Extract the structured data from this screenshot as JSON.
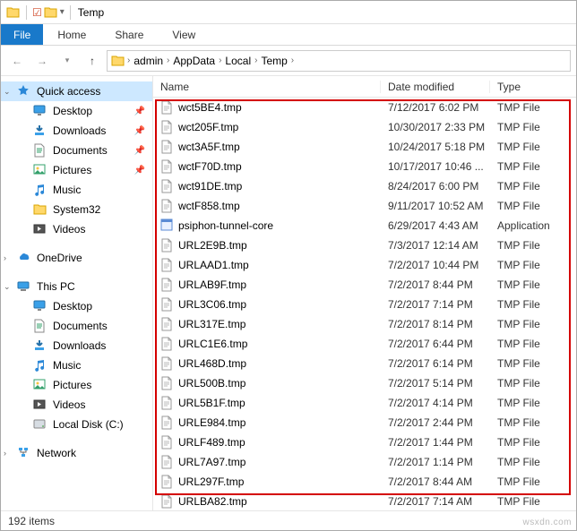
{
  "window": {
    "title": "Temp"
  },
  "ribbon": {
    "file": "File",
    "tabs": [
      "Home",
      "Share",
      "View"
    ]
  },
  "breadcrumb": [
    "admin",
    "AppData",
    "Local",
    "Temp"
  ],
  "columns": {
    "name": "Name",
    "date": "Date modified",
    "type": "Type"
  },
  "nav": {
    "quick_access": {
      "label": "Quick access",
      "items": [
        {
          "label": "Desktop",
          "pinned": true,
          "icon": "desktop"
        },
        {
          "label": "Downloads",
          "pinned": true,
          "icon": "downloads"
        },
        {
          "label": "Documents",
          "pinned": true,
          "icon": "documents"
        },
        {
          "label": "Pictures",
          "pinned": true,
          "icon": "pictures"
        },
        {
          "label": "Music",
          "pinned": false,
          "icon": "music"
        },
        {
          "label": "System32",
          "pinned": false,
          "icon": "folder"
        },
        {
          "label": "Videos",
          "pinned": false,
          "icon": "videos"
        }
      ]
    },
    "onedrive": {
      "label": "OneDrive"
    },
    "this_pc": {
      "label": "This PC",
      "items": [
        {
          "label": "Desktop",
          "icon": "desktop"
        },
        {
          "label": "Documents",
          "icon": "documents"
        },
        {
          "label": "Downloads",
          "icon": "downloads"
        },
        {
          "label": "Music",
          "icon": "music"
        },
        {
          "label": "Pictures",
          "icon": "pictures"
        },
        {
          "label": "Videos",
          "icon": "videos"
        },
        {
          "label": "Local Disk (C:)",
          "icon": "disk"
        }
      ]
    },
    "network": {
      "label": "Network"
    }
  },
  "files": [
    {
      "name": "wct5BE4.tmp",
      "date": "7/12/2017 6:02 PM",
      "type": "TMP File",
      "icon": "file"
    },
    {
      "name": "wct205F.tmp",
      "date": "10/30/2017 2:33 PM",
      "type": "TMP File",
      "icon": "file"
    },
    {
      "name": "wct3A5F.tmp",
      "date": "10/24/2017 5:18 PM",
      "type": "TMP File",
      "icon": "file"
    },
    {
      "name": "wctF70D.tmp",
      "date": "10/17/2017 10:46 ...",
      "type": "TMP File",
      "icon": "file"
    },
    {
      "name": "wct91DE.tmp",
      "date": "8/24/2017 6:00 PM",
      "type": "TMP File",
      "icon": "file"
    },
    {
      "name": "wctF858.tmp",
      "date": "9/11/2017 10:52 AM",
      "type": "TMP File",
      "icon": "file"
    },
    {
      "name": "psiphon-tunnel-core",
      "date": "6/29/2017 4:43 AM",
      "type": "Application",
      "icon": "app"
    },
    {
      "name": "URL2E9B.tmp",
      "date": "7/3/2017 12:14 AM",
      "type": "TMP File",
      "icon": "file"
    },
    {
      "name": "URLAAD1.tmp",
      "date": "7/2/2017 10:44 PM",
      "type": "TMP File",
      "icon": "file"
    },
    {
      "name": "URLAB9F.tmp",
      "date": "7/2/2017 8:44 PM",
      "type": "TMP File",
      "icon": "file"
    },
    {
      "name": "URL3C06.tmp",
      "date": "7/2/2017 7:14 PM",
      "type": "TMP File",
      "icon": "file"
    },
    {
      "name": "URL317E.tmp",
      "date": "7/2/2017 8:14 PM",
      "type": "TMP File",
      "icon": "file"
    },
    {
      "name": "URLC1E6.tmp",
      "date": "7/2/2017 6:44 PM",
      "type": "TMP File",
      "icon": "file"
    },
    {
      "name": "URL468D.tmp",
      "date": "7/2/2017 6:14 PM",
      "type": "TMP File",
      "icon": "file"
    },
    {
      "name": "URL500B.tmp",
      "date": "7/2/2017 5:14 PM",
      "type": "TMP File",
      "icon": "file"
    },
    {
      "name": "URL5B1F.tmp",
      "date": "7/2/2017 4:14 PM",
      "type": "TMP File",
      "icon": "file"
    },
    {
      "name": "URLE984.tmp",
      "date": "7/2/2017 2:44 PM",
      "type": "TMP File",
      "icon": "file"
    },
    {
      "name": "URLF489.tmp",
      "date": "7/2/2017 1:44 PM",
      "type": "TMP File",
      "icon": "file"
    },
    {
      "name": "URL7A97.tmp",
      "date": "7/2/2017 1:14 PM",
      "type": "TMP File",
      "icon": "file"
    },
    {
      "name": "URL297F.tmp",
      "date": "7/2/2017 8:44 AM",
      "type": "TMP File",
      "icon": "file"
    },
    {
      "name": "URLBA82.tmp",
      "date": "7/2/2017 7:14 AM",
      "type": "TMP File",
      "icon": "file"
    }
  ],
  "status": {
    "count": "192 items"
  },
  "watermark": "wsxdn.com"
}
